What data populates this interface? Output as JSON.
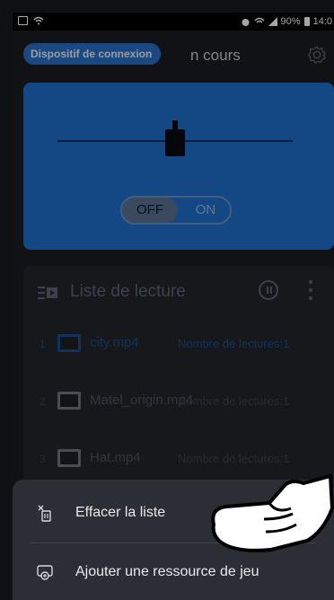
{
  "status": {
    "battery": "90%",
    "time": "14:0"
  },
  "header": {
    "device_label": "Dispositif de connexion",
    "title_fragment": "n cours"
  },
  "toggle": {
    "off_label": "OFF",
    "on_label": "ON"
  },
  "playlist": {
    "title": "Liste de lecture",
    "items": [
      {
        "index": "1",
        "name": "city.mp4",
        "plays": "Nombre de lectures:1"
      },
      {
        "index": "2",
        "name": "Matel_origin.mp4",
        "plays": "Nombre de lectures:1"
      },
      {
        "index": "3",
        "name": "Hat.mp4",
        "plays": "Nombre de lectures:1"
      }
    ]
  },
  "sheet": {
    "clear_label": "Effacer la liste",
    "add_label": "Ajouter une ressource de jeu"
  },
  "colors": {
    "accent": "#1f6fcc",
    "pill": "#2a6fc7"
  }
}
